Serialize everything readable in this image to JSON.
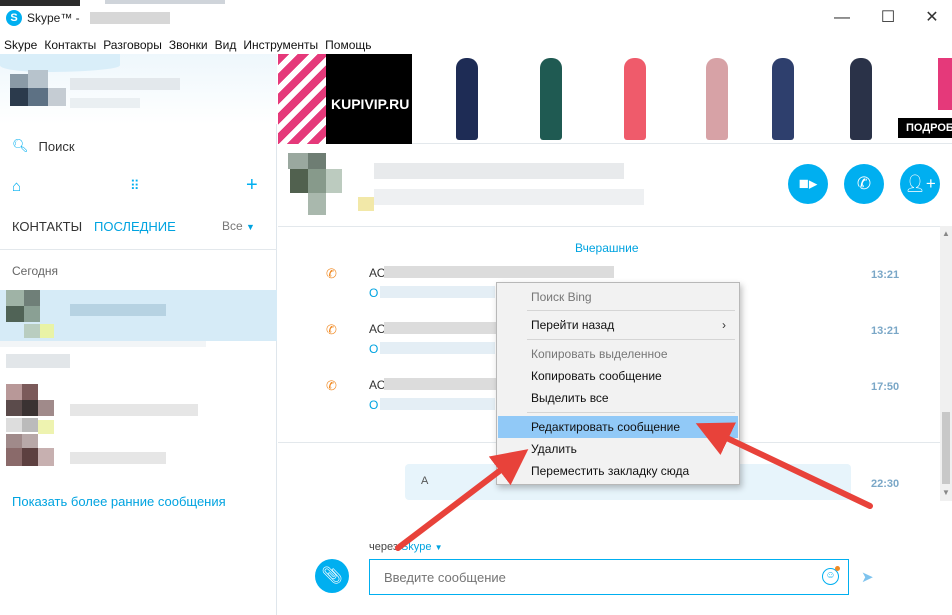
{
  "window": {
    "app_title": "Skype™ -",
    "logo_letter": "S",
    "minimize_glyph": "—",
    "maximize_glyph": "☐",
    "close_glyph": "✕"
  },
  "menu": [
    "Skype",
    "Контакты",
    "Разговоры",
    "Звонки",
    "Вид",
    "Инструменты",
    "Помощь"
  ],
  "sidebar": {
    "search_label": "Поиск",
    "home_glyph": "⌂",
    "dialpad_glyph": "⠿",
    "add_glyph": "+",
    "tab_contacts": "КОНТАКТЫ",
    "tab_recent": "ПОСЛЕДНИЕ",
    "filter_label": "Все",
    "section_today": "Сегодня",
    "show_earlier": "Показать более ранние сообщения"
  },
  "ad": {
    "brand": "KUPIVIP.RU",
    "cta": "ПОДРОБ"
  },
  "conversation": {
    "date_separator": "Вчерашние",
    "messages": [
      {
        "prefix": "АС",
        "link": "О",
        "time": "13:21"
      },
      {
        "prefix": "АС",
        "link": "О",
        "time": "13:21"
      },
      {
        "prefix": "АС",
        "link": "О",
        "time": "17:50"
      },
      {
        "prefix": "А",
        "time": "22:30"
      }
    ]
  },
  "context_menu": {
    "items": [
      {
        "label": "Поиск Bing",
        "disabled": true
      },
      {
        "label": "Перейти назад",
        "submenu": true
      },
      {
        "label": "Копировать выделенное",
        "disabled": true
      },
      {
        "label": "Копировать сообщение"
      },
      {
        "label": "Выделить все"
      },
      {
        "label": "Редактировать сообщение",
        "highlighted": true
      },
      {
        "label": "Удалить"
      },
      {
        "label": "Переместить закладку сюда"
      }
    ]
  },
  "composer": {
    "via_prefix": "через",
    "via_link": "Skype",
    "placeholder": "Введите сообщение"
  },
  "colors": {
    "accent": "#00aff0",
    "selection": "#91c9f7",
    "arrow": "#e8423a"
  }
}
